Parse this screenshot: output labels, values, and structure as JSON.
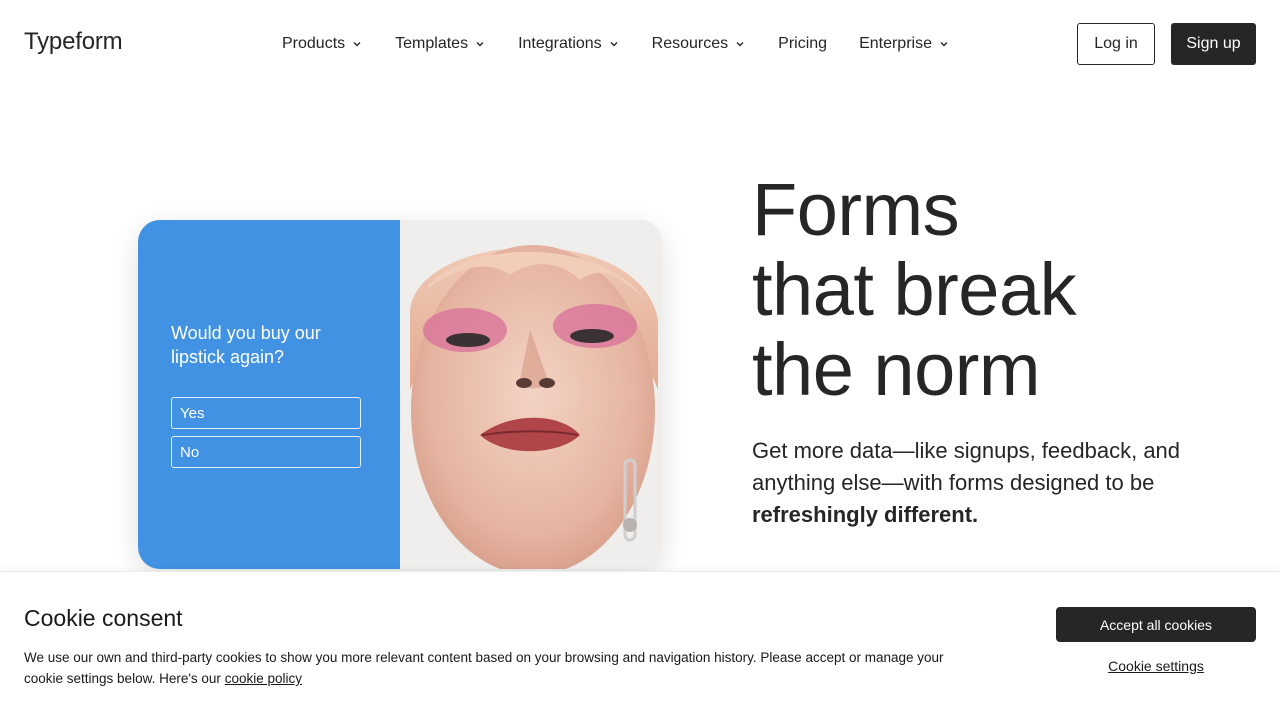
{
  "header": {
    "logo": "Typeform",
    "nav": [
      {
        "label": "Products",
        "has_dropdown": true
      },
      {
        "label": "Templates",
        "has_dropdown": true
      },
      {
        "label": "Integrations",
        "has_dropdown": true
      },
      {
        "label": "Resources",
        "has_dropdown": true
      },
      {
        "label": "Pricing",
        "has_dropdown": false
      },
      {
        "label": "Enterprise",
        "has_dropdown": true
      }
    ],
    "login_label": "Log in",
    "signup_label": "Sign up"
  },
  "hero": {
    "title_lines": [
      "Forms",
      "that break",
      "the norm"
    ],
    "subtitle_prefix": "Get more data—like signups, feedback, and anything else—with forms designed to be ",
    "subtitle_bold": "refreshingly different.",
    "card": {
      "question": "Would you buy our lipstick again?",
      "options": [
        "Yes",
        "No"
      ],
      "accent_color": "#4192e2"
    }
  },
  "cookie": {
    "title": "Cookie consent",
    "text": "We use our own and third-party cookies to show you more relevant content based on your browsing and navigation history. Please accept or manage your cookie settings below. Here's our ",
    "link_label": "cookie policy",
    "accept_label": "Accept all cookies",
    "settings_label": "Cookie settings"
  },
  "colors": {
    "primary_dark": "#262627",
    "card_blue": "#4192e2",
    "background": "#ffffff"
  }
}
